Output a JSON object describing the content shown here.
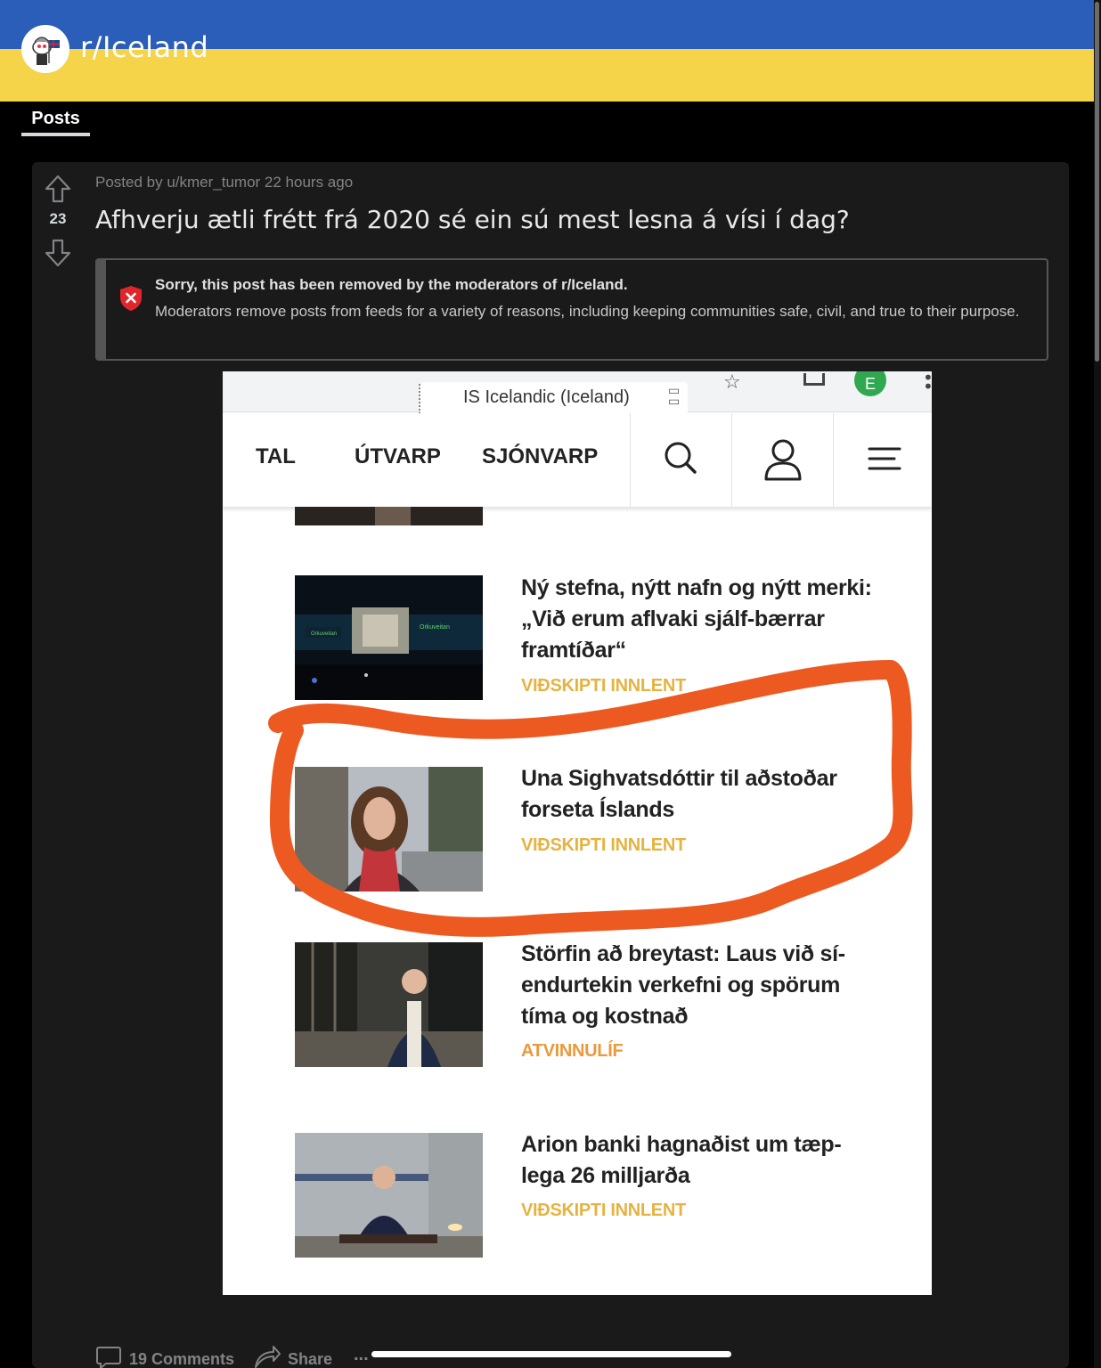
{
  "community": {
    "name": "r/Iceland",
    "banner_colors": {
      "top": "#2b5eb8",
      "bottom": "#f5d44a"
    }
  },
  "tabs": [
    {
      "label": "Posts"
    }
  ],
  "post": {
    "votes": "23",
    "meta": "Posted by u/kmer_tumor 22 hours ago",
    "title": "Afhverju ætli frétt frá 2020 sé ein sú mest lesna á vísi í dag?",
    "removed": {
      "heading": "Sorry, this post has been removed by the moderators of r/Iceland.",
      "body": "Moderators remove posts from feeds for a variety of reasons, including keeping communities safe, civil, and true to their purpose."
    },
    "actions": {
      "comments": "19 Comments",
      "share": "Share",
      "more": "..."
    }
  },
  "screenshot": {
    "translate_bar": {
      "language": "IS  Icelandic (Iceland)",
      "avatar_letter": "E"
    },
    "nav": {
      "links": [
        "TAL",
        "ÚTVARP",
        "SJÓNVARP"
      ],
      "icons": [
        "search-icon",
        "user-icon",
        "hamburger-menu-icon"
      ]
    },
    "articles": [
      {
        "headline": "Ný stefna, nýtt nafn og nýtt merki: „Við erum aflvaki sjálf-bærrar framtíðar“",
        "category": "VIÐSKIPTI INNLENT"
      },
      {
        "headline": "Una Sighvatsdóttir til aðstoðar forseta Íslands",
        "category": "VIÐSKIPTI INNLENT"
      },
      {
        "headline": "Störfin að breytast: Laus við sí-endurtekin verkefni og spörum tíma og kostnað",
        "category": "ATVINNULÍF"
      },
      {
        "headline": "Arion banki hagnaðist um tæp-lega 26 milljarða",
        "category": "VIÐSKIPTI INNLENT"
      }
    ],
    "highlight_color": "#ec5a22"
  }
}
